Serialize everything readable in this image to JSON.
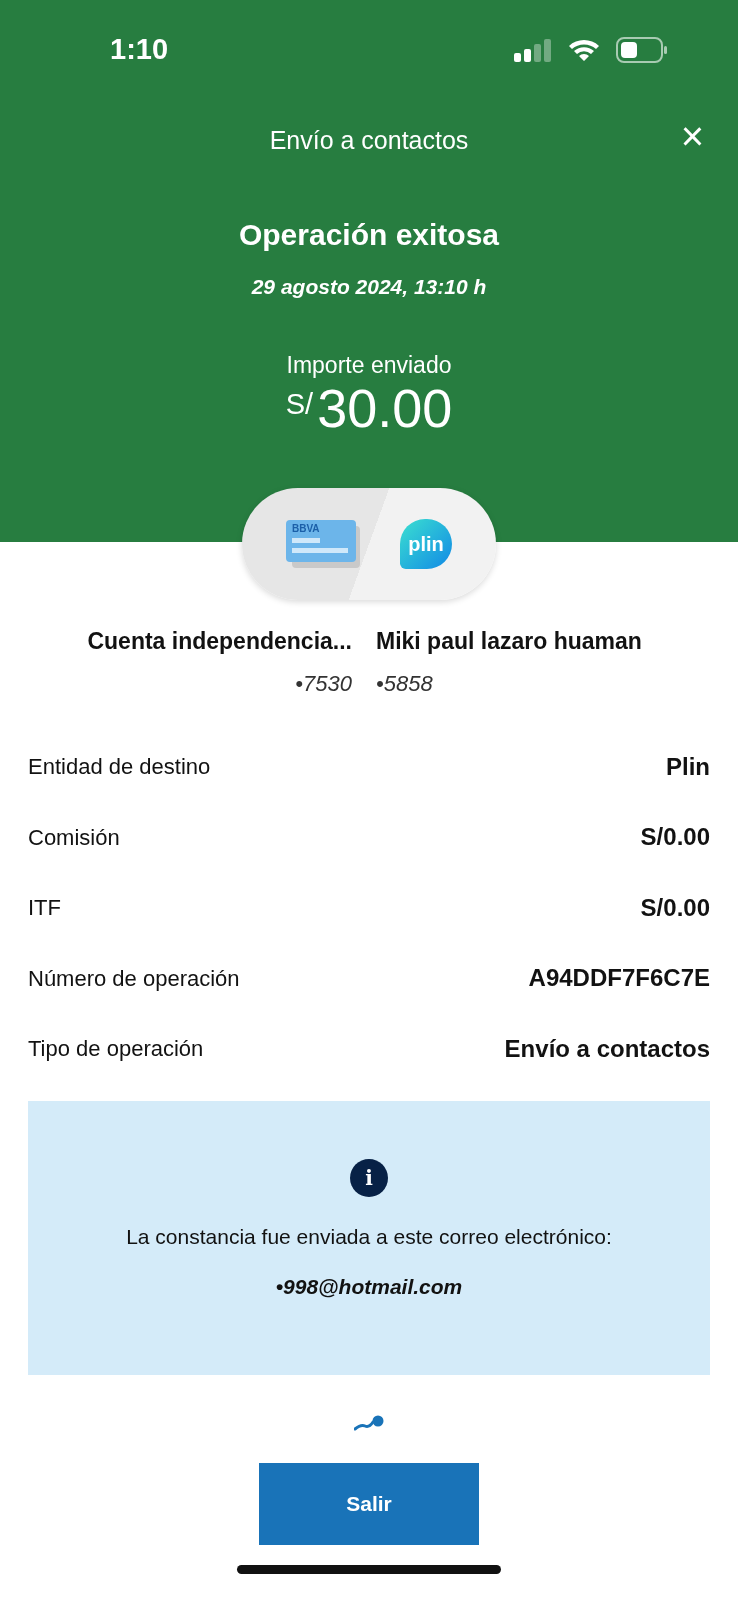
{
  "status_bar": {
    "time": "1:10"
  },
  "header": {
    "title": "Envío a contactos",
    "close": "×"
  },
  "result": {
    "title": "Operación exitosa",
    "date": "29 agosto 2024, 13:10 h",
    "amount_label": "Importe enviado",
    "currency": "S/",
    "amount": "30.00"
  },
  "transfer": {
    "origin_logo": "BBVA",
    "destination_logo": "plin",
    "origin_name": "Cuenta independencia...",
    "origin_number": "•7530",
    "destination_name": "Miki paul lazaro huaman",
    "destination_number": "•5858"
  },
  "details": [
    {
      "label": "Entidad de destino",
      "value": "Plin"
    },
    {
      "label": "Comisión",
      "value": "S/0.00"
    },
    {
      "label": "ITF",
      "value": "S/0.00"
    },
    {
      "label": "Número de operación",
      "value": "A94DDF7F6C7E"
    },
    {
      "label": "Tipo de operación",
      "value": "Envío a contactos"
    }
  ],
  "notice": {
    "icon": "i",
    "text": "La constancia fue enviada a este correo electrónico:",
    "email": "•998@hotmail.com"
  },
  "exit_button": "Salir"
}
